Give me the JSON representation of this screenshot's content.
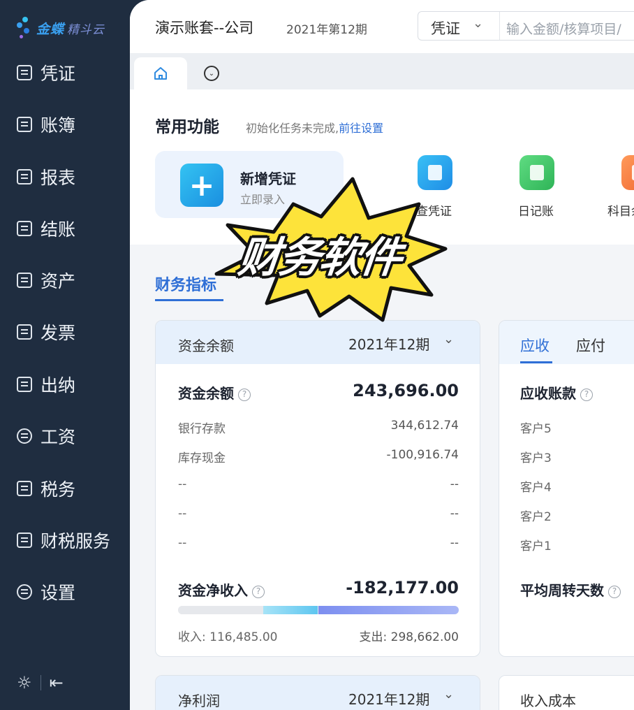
{
  "app": {
    "logo_text": "金蝶",
    "logo_sub": "精斗云"
  },
  "sidebar": {
    "items": [
      {
        "label": "凭证",
        "icon": "voucher-icon"
      },
      {
        "label": "账簿",
        "icon": "ledger-icon"
      },
      {
        "label": "报表",
        "icon": "report-icon"
      },
      {
        "label": "结账",
        "icon": "closing-icon"
      },
      {
        "label": "资产",
        "icon": "asset-icon"
      },
      {
        "label": "发票",
        "icon": "invoice-icon"
      },
      {
        "label": "出纳",
        "icon": "cashier-icon"
      },
      {
        "label": "工资",
        "icon": "salary-icon"
      },
      {
        "label": "税务",
        "icon": "tax-icon"
      },
      {
        "label": "财税服务",
        "icon": "service-icon"
      },
      {
        "label": "设置",
        "icon": "settings-icon"
      }
    ]
  },
  "header": {
    "book_title": "演示账套--公司",
    "period": "2021年第12期",
    "search_type": "凭证",
    "search_placeholder": "输入金额/核算项目/"
  },
  "quick": {
    "title": "常用功能",
    "hint": "初始化任务未完成,",
    "hint_link": "前往设置",
    "new_voucher_title": "新增凭证",
    "new_voucher_sub": "立即录入",
    "items": [
      {
        "label": "查凭证",
        "color": "#2fa8f0"
      },
      {
        "label": "日记账",
        "color": "#3cc86a"
      },
      {
        "label": "科目余",
        "color": "#f3743a"
      }
    ]
  },
  "metrics": {
    "tab_label": "财务指标",
    "funds": {
      "title": "资金余额",
      "period": "2021年12期",
      "total_label": "资金余额",
      "total_value": "243,696.00",
      "rows": [
        {
          "label": "银行存款",
          "value": "344,612.74"
        },
        {
          "label": "库存现金",
          "value": "-100,916.74"
        },
        {
          "label": "--",
          "value": "--"
        },
        {
          "label": "--",
          "value": "--"
        },
        {
          "label": "--",
          "value": "--"
        }
      ],
      "net_label": "资金净收入",
      "net_value": "-182,177.00",
      "income_label": "收入:",
      "income_value": "116,485.00",
      "expense_label": "支出:",
      "expense_value": "298,662.00"
    },
    "receivable": {
      "tab_receive": "应收",
      "tab_pay": "应付",
      "title": "应收账款",
      "customers": [
        "客户5",
        "客户3",
        "客户4",
        "客户2",
        "客户1"
      ],
      "turnover_label": "平均周转天数"
    },
    "profit": {
      "title": "净利润",
      "period": "2021年12期"
    },
    "revenue_cost": {
      "title": "收入成本"
    }
  },
  "overlay": {
    "text": "财务软件"
  }
}
